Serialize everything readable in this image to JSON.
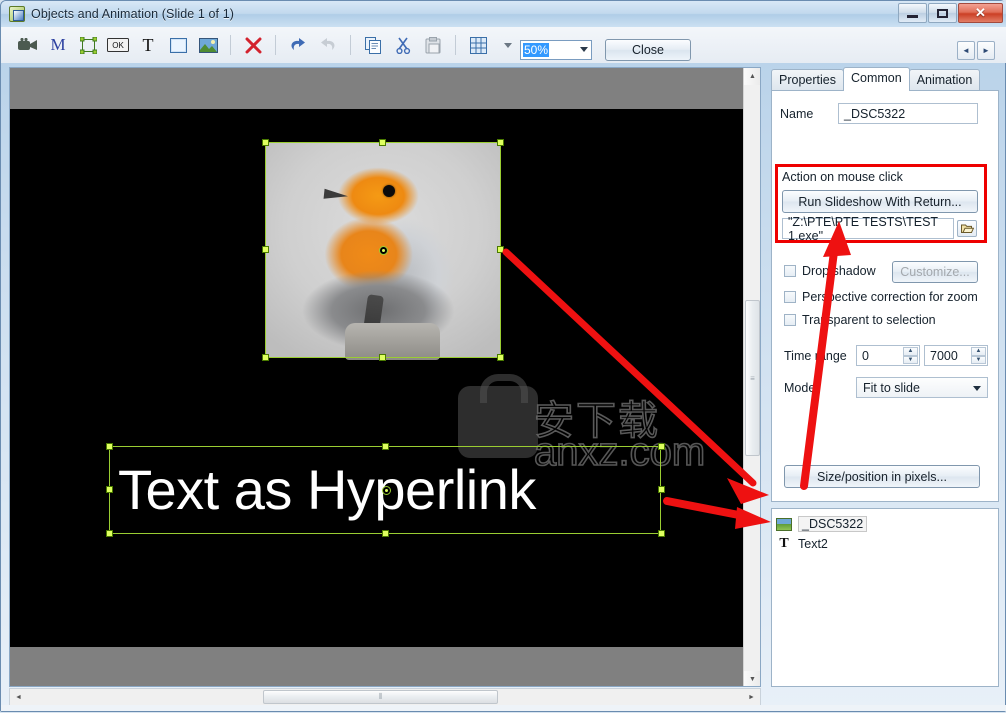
{
  "window": {
    "title": "Objects and Animation  (Slide 1 of 1)",
    "icon": "app-icon",
    "controls": {
      "minimize": "–",
      "maximize": "□",
      "close": "✕"
    }
  },
  "toolbar": {
    "icons": [
      {
        "name": "video-camera-icon",
        "glyph": "📹"
      },
      {
        "name": "mask-m-icon",
        "glyph": "M"
      },
      {
        "name": "frame-rect-icon",
        "glyph": "⬚"
      },
      {
        "name": "button-ok-icon",
        "glyph": "OK"
      },
      {
        "name": "text-tool-icon",
        "glyph": "T"
      },
      {
        "name": "rectangle-icon",
        "glyph": "▣"
      },
      {
        "name": "add-image-icon",
        "glyph": "🖼"
      },
      {
        "name": "delete-icon",
        "glyph": "✕"
      },
      {
        "name": "undo-icon",
        "glyph": "↶"
      },
      {
        "name": "redo-icon",
        "glyph": "↷"
      },
      {
        "name": "copy-icon",
        "glyph": "❐"
      },
      {
        "name": "cut-icon",
        "glyph": "✂"
      },
      {
        "name": "paste-icon",
        "glyph": "📋"
      },
      {
        "name": "grid-icon",
        "glyph": "▦"
      }
    ],
    "zoom_value": "50%",
    "close_label": "Close",
    "nav_prev": "◄",
    "nav_next": "►"
  },
  "canvas": {
    "slide_background": "#000000",
    "workspace_background": "#808080",
    "text_object": "Text as Hyperlink",
    "watermark": {
      "cn": "安下载",
      "domain": "anxz.com"
    },
    "vscroll": {
      "up": "▲",
      "down": "▼",
      "grip": "≡"
    },
    "hscroll": {
      "left": "◄",
      "right": "►",
      "grip": "⦀"
    }
  },
  "panel": {
    "tabs": [
      {
        "label": "Properties",
        "active": false
      },
      {
        "label": "Common",
        "active": true
      },
      {
        "label": "Animation",
        "active": false
      }
    ],
    "name_label": "Name",
    "name_value": "_DSC5322",
    "action_group_label": "Action on mouse click",
    "action_button": "Run Slideshow With Return...",
    "action_path": "\"Z:\\PTE\\PTE TESTS\\TEST 1.exe\"",
    "browse_icon": "folder-open-icon",
    "checkboxes": [
      {
        "label": "Drop shadow",
        "checked": false
      },
      {
        "label": "Perspective correction for zoom",
        "checked": false
      },
      {
        "label": "Transparent to selection",
        "checked": false
      }
    ],
    "customize_button": "Customize...",
    "time_range_label": "Time range",
    "time_range_start": "0",
    "time_range_end": "7000",
    "mode_label": "Mode",
    "mode_value": "Fit to slide",
    "size_position_button": "Size/position in pixels...",
    "highlight_color": "#ee0000"
  },
  "object_list": [
    {
      "name": "_DSC5322",
      "icon": "image-icon",
      "selected": true
    },
    {
      "name": "Text2",
      "icon": "text-icon",
      "selected": false
    }
  ]
}
